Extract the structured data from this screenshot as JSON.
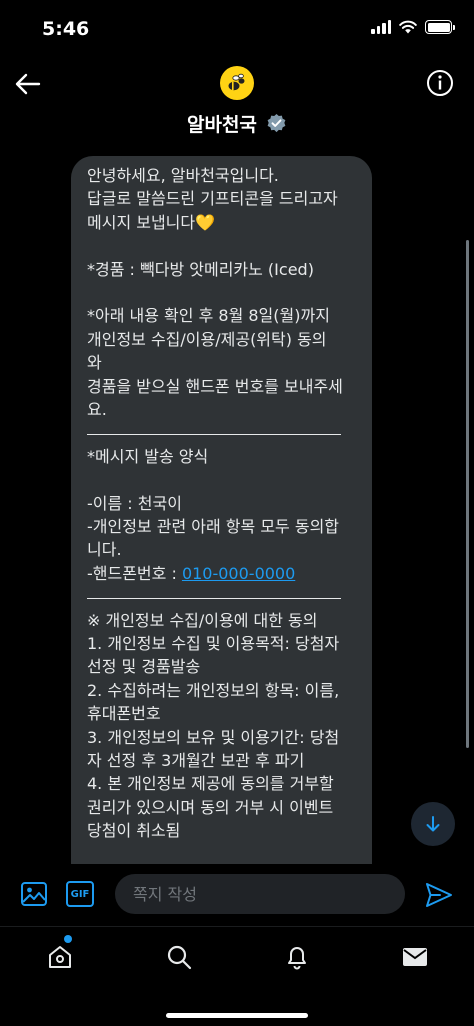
{
  "status": {
    "time": "5:46"
  },
  "header": {
    "title": "알바천국"
  },
  "message": {
    "lines": [
      {
        "kind": "text",
        "text": "안녕하세요, 알바천국입니다."
      },
      {
        "kind": "text",
        "text": "답글로 말씀드린 기프티콘을 드리고자"
      },
      {
        "kind": "text",
        "text": "메시지 보냅니다💛"
      },
      {
        "kind": "blank"
      },
      {
        "kind": "text",
        "text": "*경품 : 빽다방 앗메리카노 (Iced)"
      },
      {
        "kind": "blank"
      },
      {
        "kind": "text",
        "text": "*아래 내용 확인 후 8월 8일(월)까지"
      },
      {
        "kind": "text",
        "text": "개인정보 수집/이용/제공(위탁) 동의"
      },
      {
        "kind": "text",
        "text": "와"
      },
      {
        "kind": "text",
        "text": "경품을 받으실 핸드폰 번호를 보내주세"
      },
      {
        "kind": "text",
        "text": "요."
      },
      {
        "kind": "separator"
      },
      {
        "kind": "text",
        "text": "*메시지 발송 양식"
      },
      {
        "kind": "blank"
      },
      {
        "kind": "text",
        "text": "-이름 : 천국이"
      },
      {
        "kind": "text",
        "text": "-개인정보 관련 아래 항목 모두 동의합"
      },
      {
        "kind": "text",
        "text": "니다."
      },
      {
        "kind": "phone",
        "text": "-핸드폰번호 : ",
        "link": "010-000-0000"
      },
      {
        "kind": "separator"
      },
      {
        "kind": "text",
        "text": "※ 개인정보 수집/이용에 대한 동의"
      },
      {
        "kind": "text",
        "text": "1. 개인정보 수집 및 이용목적: 당첨자"
      },
      {
        "kind": "text",
        "text": "선정 및 경품발송"
      },
      {
        "kind": "text",
        "text": "2. 수집하려는 개인정보의 항목: 이름,"
      },
      {
        "kind": "text",
        "text": "휴대폰번호"
      },
      {
        "kind": "text",
        "text": "3. 개인정보의 보유 및 이용기간: 당첨"
      },
      {
        "kind": "text",
        "text": "자 선정 후 3개월간 보관 후 파기"
      },
      {
        "kind": "text",
        "text": "4. 본 개인정보 제공에 동의를 거부할"
      },
      {
        "kind": "text",
        "text": "권리가 있으시며 동의 거부 시 이벤트"
      },
      {
        "kind": "text",
        "text": "당첨이 취소됨"
      }
    ]
  },
  "composer": {
    "placeholder": "쪽지 작성",
    "gif_label": "GIF"
  },
  "icons": {
    "back": "back-arrow-icon",
    "info": "info-icon",
    "verified": "verified-badge-icon",
    "image": "image-icon",
    "send": "send-icon",
    "scroll_down": "arrow-down-icon",
    "home": "home-icon",
    "search": "search-icon",
    "notifications": "bell-icon",
    "messages": "mail-icon"
  },
  "colors": {
    "accent": "#1d9bf0",
    "bubble": "#2f3336",
    "avatar": "#ffd314",
    "background": "#000000"
  }
}
